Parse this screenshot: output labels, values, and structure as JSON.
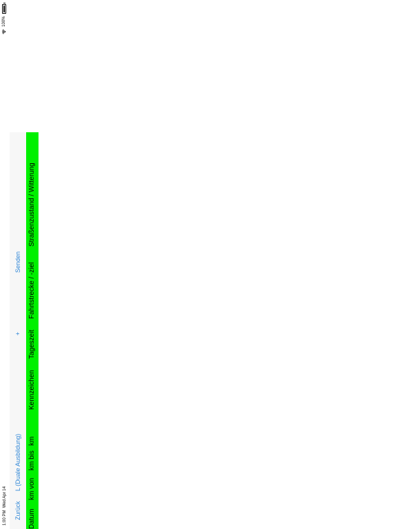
{
  "status_bar": {
    "time": "1:00 PM",
    "date": "Wed Apr 14",
    "battery": "100%",
    "icons": [
      "wifi-icon",
      "battery-icon"
    ]
  },
  "navbar": {
    "back_label": "Zurück",
    "title": "L (Duale Ausbildung)",
    "add_label": "+",
    "send_label": "Senden",
    "accent_color": "#2f86d6"
  },
  "table": {
    "header_color": "#00f000",
    "columns": [
      "Datum",
      "km von",
      "km bis",
      "km",
      "Kennzeichen",
      "Tageszeit",
      "Fahrtstrecke / -ziel",
      "Straßenzustand / Witterung"
    ]
  }
}
